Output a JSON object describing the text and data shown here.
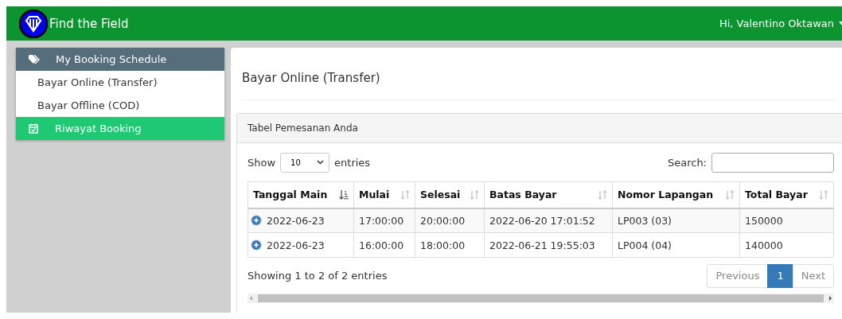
{
  "navbar": {
    "brand": "Find the Field",
    "user": "Hi, Valentino Oktawan"
  },
  "sidebar": {
    "items": [
      {
        "label": "My Booking Schedule",
        "kind": "header",
        "selected": false
      },
      {
        "label": "Bayar Online (Transfer)",
        "kind": "link",
        "selected": false
      },
      {
        "label": "Bayar Offline (COD)",
        "kind": "link",
        "selected": false
      },
      {
        "label": "Riwayat Booking",
        "kind": "icon_link",
        "selected": true
      }
    ]
  },
  "page_title": "Bayar Online (Transfer)",
  "panel": {
    "title": "Tabel Pemesanan Anda",
    "length": {
      "show_label": "Show",
      "value": "10",
      "entries_label": "entries"
    },
    "search": {
      "label": "Search:"
    },
    "table": {
      "columns": [
        {
          "label": "Tanggal Main",
          "sorted": true
        },
        {
          "label": "Mulai",
          "sorted": false
        },
        {
          "label": "Selesai",
          "sorted": false
        },
        {
          "label": "Batas Bayar",
          "sorted": false
        },
        {
          "label": "Nomor Lapangan",
          "sorted": false
        },
        {
          "label": "Total Bayar",
          "sorted": false
        }
      ],
      "rows": [
        [
          "2022-06-23",
          "17:00:00",
          "20:00:00",
          "2022-06-20 17:01:52",
          "LP003 (03)",
          "150000"
        ],
        [
          "2022-06-23",
          "16:00:00",
          "18:00:00",
          "2022-06-21 19:55:03",
          "LP004 (04)",
          "140000"
        ]
      ]
    },
    "info": "Showing 1 to 2 of 2 entries",
    "pagination": [
      {
        "label": "Previous",
        "selected": false,
        "disabled": true
      },
      {
        "label": "1",
        "selected": true,
        "disabled": false
      },
      {
        "label": "Next",
        "selected": false,
        "disabled": true
      }
    ]
  }
}
